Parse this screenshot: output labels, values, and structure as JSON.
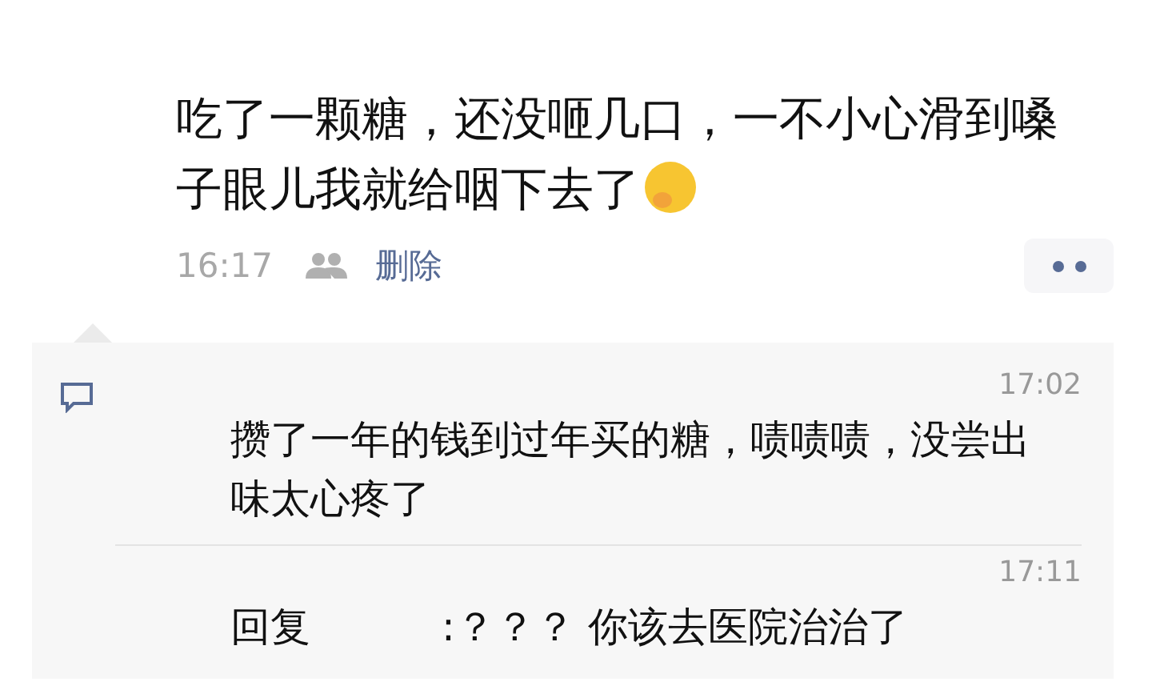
{
  "post": {
    "text": "吃了一颗糖，还没咂几口，一不小心滑到嗓子眼儿我就给咽下去了",
    "time": "16:17",
    "delete": "删除"
  },
  "comments": [
    {
      "kind": "comment",
      "time": "17:02",
      "text": "攒了一年的钱到过年买的糖，啧啧啧，没尝出味太心疼了"
    },
    {
      "kind": "reply",
      "time": "17:11",
      "prefix": "回复",
      "text": ":？？？ 你该去医院治治了"
    }
  ]
}
